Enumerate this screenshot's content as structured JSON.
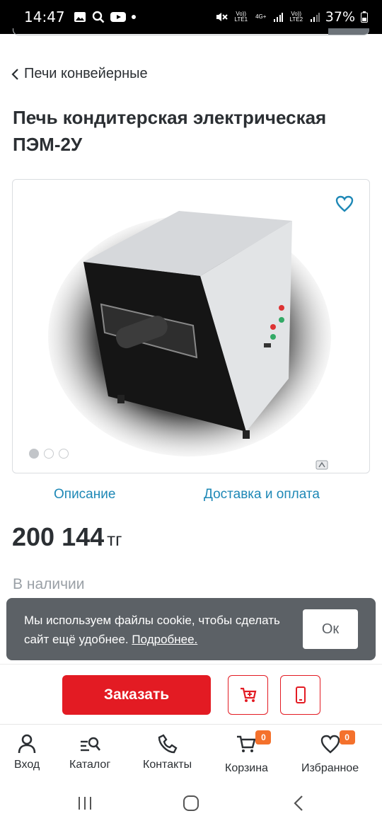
{
  "status_bar": {
    "time": "14:47",
    "signal1": "Vo)) LTE1",
    "signal2": "4G+",
    "signal3": "Vo)) LTE2",
    "battery": "37%"
  },
  "breadcrumb": {
    "back_label": "Печи конвейерные"
  },
  "product": {
    "title": "Печь кондитерская электрическая ПЭМ-2У",
    "gallery_dots": 3,
    "active_dot": 0,
    "price_value": "200 144",
    "price_currency": "тг",
    "stock": "В наличии"
  },
  "tabs": [
    {
      "label": "Описание"
    },
    {
      "label": "Доставка и оплата"
    }
  ],
  "cookie": {
    "message": "Мы используем файлы cookie, чтобы сделать сайт ещё удобнее.",
    "link": "Подробнее.",
    "ok_label": "Ок"
  },
  "actions": {
    "order_label": "Заказать"
  },
  "bottom_nav": [
    {
      "label": "Вход",
      "icon": "user-icon"
    },
    {
      "label": "Каталог",
      "icon": "catalog-search-icon"
    },
    {
      "label": "Контакты",
      "icon": "phone-icon"
    },
    {
      "label": "Корзина",
      "icon": "cart-icon",
      "badge": "0"
    },
    {
      "label": "Избранное",
      "icon": "heart-icon",
      "badge": "0"
    }
  ],
  "colors": {
    "accent_red": "#e31b23",
    "link_blue": "#1e88b6",
    "badge_orange": "#f4712c",
    "cookie_bg": "#5c6166"
  }
}
